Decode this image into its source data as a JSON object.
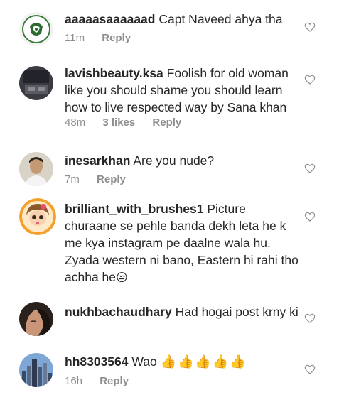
{
  "comments": [
    {
      "username": "aaaaasaaaaaad",
      "text": "Capt Naveed ahya tha",
      "time": "11m",
      "reply": "Reply",
      "avatar": "pakistan-army-logo-avatar"
    },
    {
      "username": "lavishbeauty.ksa",
      "text": "Foolish for old woman like you should shame  you should learn how to live respected way by Sana khan",
      "time": "48m",
      "likes": "3 likes",
      "reply": "Reply",
      "avatar": "room-photo-avatar"
    },
    {
      "username": "inesarkhan",
      "text": "Are you nude?",
      "time": "7m",
      "reply": "Reply",
      "avatar": "man-portrait-avatar"
    },
    {
      "username": "brilliant_with_brushes1",
      "text": "Picture churaane se pehle banda dekh leta he k me kya instagram pe daalne wala hu. Zyada western ni bano, Eastern hi rahi tho achha he",
      "emoji": "😒",
      "avatar": "cartoon-girl-avatar"
    },
    {
      "username": "nukhbachaudhary",
      "text": "Had hogai post krny ki",
      "avatar": "woman-profile-avatar"
    },
    {
      "username": "hh8303564",
      "text": "Wao",
      "emoji": "👍👍👍👍👍",
      "time": "16h",
      "reply": "Reply",
      "avatar": "city-skyline-avatar"
    }
  ]
}
